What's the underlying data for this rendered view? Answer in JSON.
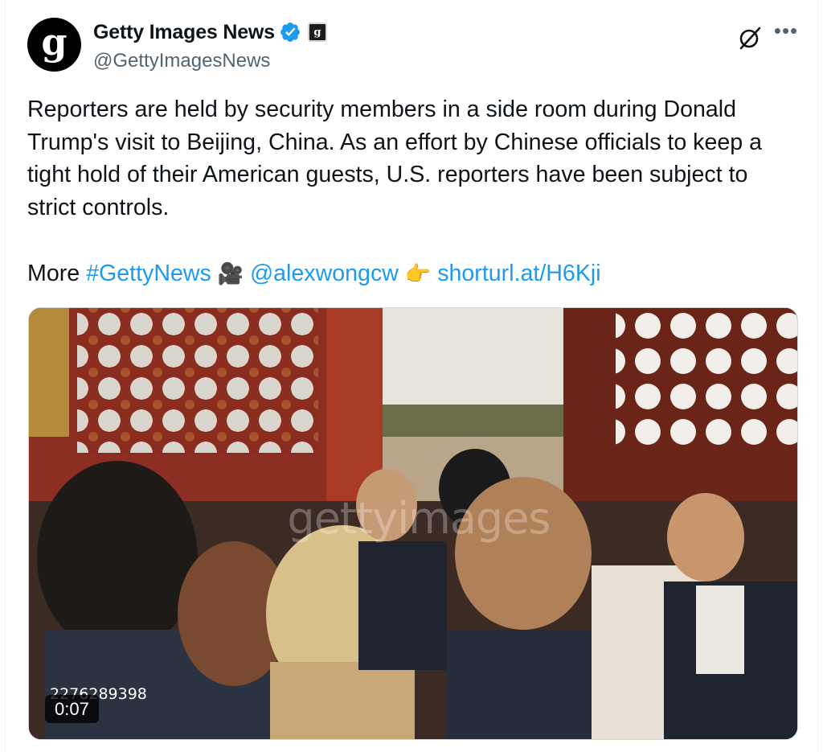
{
  "account": {
    "avatar_letter": "g",
    "display_name": "Getty Images News",
    "affiliate_badge_letter": "g",
    "handle": "@GettyImagesNews",
    "verified_color": "#1d9bf0"
  },
  "icons": {
    "grok": "grok-icon",
    "more": "more-icon"
  },
  "tweet": {
    "text": "Reporters are held by security members in a side room during Donald Trump's visit to Beijing, China. As an effort by Chinese officials to keep a tight hold of their American guests, U.S. reporters have been subject to strict controls.",
    "more_label": "More",
    "hashtag": "#GettyNews",
    "camera_emoji": "🎥",
    "mention": "@alexwongcw",
    "pointing_emoji": "👉",
    "short_url": "shorturl.at/H6Kji",
    "link_color": "#1d9bf0"
  },
  "media": {
    "watermark": "gettyimages",
    "image_id": "2276289398",
    "duration": "0:07"
  }
}
